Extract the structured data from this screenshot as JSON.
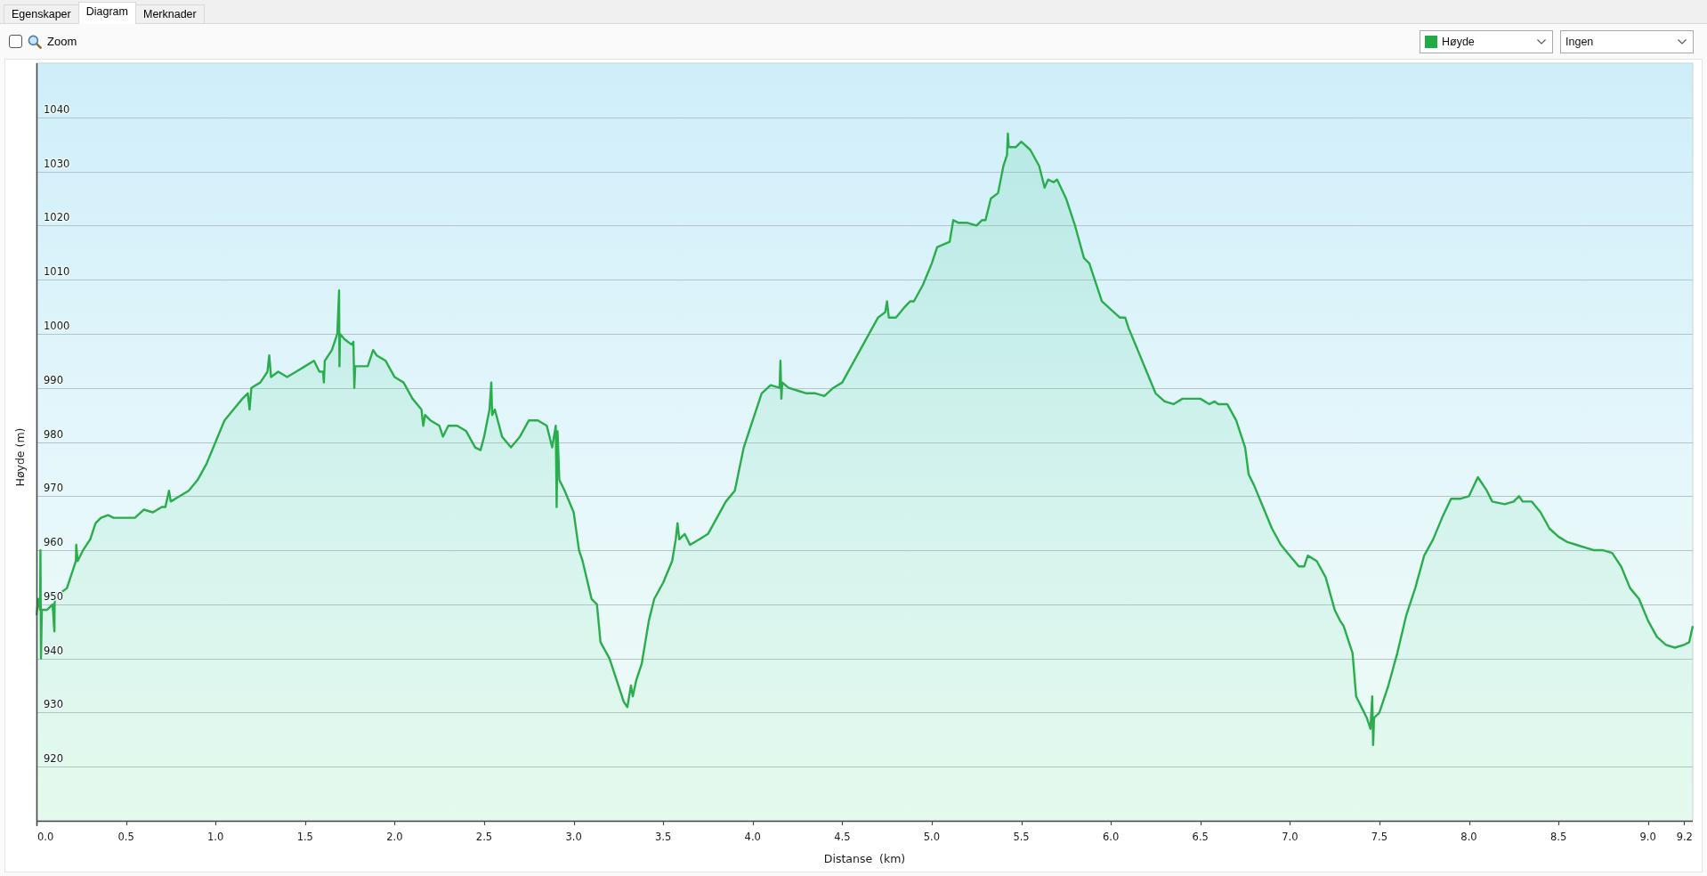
{
  "tabs": [
    {
      "label": "Egenskaper",
      "selected": false
    },
    {
      "label": "Diagram",
      "selected": true
    },
    {
      "label": "Merknader",
      "selected": false
    }
  ],
  "toolbar": {
    "zoom": {
      "label": "Zoom",
      "checked": false
    },
    "dropdowns": [
      {
        "kind": "series",
        "value": "Høyde",
        "color": "#22aa44"
      },
      {
        "kind": "plain",
        "value": "Ingen"
      }
    ]
  },
  "chart": {
    "chart_data": {
      "type": "area",
      "xlabel": "Distanse  (km)",
      "ylabel": "Høyde (m)",
      "grid": true,
      "x": [
        0,
        0.01,
        0.02,
        0.022,
        0.025,
        0.03,
        0.06,
        0.09,
        0.1,
        0.102,
        0.13,
        0.17,
        0.2,
        0.22,
        0.222,
        0.23,
        0.26,
        0.3,
        0.33,
        0.36,
        0.4,
        0.43,
        0.5,
        0.55,
        0.6,
        0.65,
        0.7,
        0.72,
        0.74,
        0.75,
        0.8,
        0.85,
        0.9,
        0.95,
        1.0,
        1.05,
        1.1,
        1.15,
        1.18,
        1.19,
        1.2,
        1.25,
        1.29,
        1.3,
        1.31,
        1.35,
        1.4,
        1.45,
        1.5,
        1.55,
        1.58,
        1.6,
        1.605,
        1.61,
        1.65,
        1.68,
        1.69,
        1.692,
        1.695,
        1.72,
        1.76,
        1.77,
        1.775,
        1.78,
        1.85,
        1.88,
        1.9,
        1.95,
        2.0,
        2.05,
        2.1,
        2.15,
        2.16,
        2.17,
        2.2,
        2.25,
        2.27,
        2.3,
        2.35,
        2.4,
        2.45,
        2.48,
        2.5,
        2.53,
        2.54,
        2.545,
        2.56,
        2.6,
        2.65,
        2.7,
        2.75,
        2.8,
        2.85,
        2.88,
        2.9,
        2.905,
        2.91,
        2.92,
        2.95,
        3.0,
        3.03,
        3.05,
        3.1,
        3.13,
        3.15,
        3.2,
        3.25,
        3.28,
        3.3,
        3.32,
        3.33,
        3.35,
        3.38,
        3.42,
        3.45,
        3.5,
        3.55,
        3.57,
        3.58,
        3.59,
        3.62,
        3.65,
        3.7,
        3.75,
        3.8,
        3.85,
        3.9,
        3.95,
        4.0,
        4.05,
        4.1,
        4.15,
        4.155,
        4.16,
        4.165,
        4.2,
        4.25,
        4.3,
        4.35,
        4.4,
        4.45,
        4.5,
        4.55,
        4.6,
        4.65,
        4.7,
        4.74,
        4.75,
        4.76,
        4.8,
        4.85,
        4.88,
        4.9,
        4.95,
        5.0,
        5.03,
        5.1,
        5.12,
        5.15,
        5.2,
        5.25,
        5.28,
        5.3,
        5.33,
        5.37,
        5.4,
        5.42,
        5.425,
        5.43,
        5.47,
        5.5,
        5.55,
        5.6,
        5.63,
        5.65,
        5.68,
        5.7,
        5.75,
        5.8,
        5.85,
        5.88,
        5.9,
        5.95,
        6.0,
        6.05,
        6.08,
        6.1,
        6.15,
        6.2,
        6.25,
        6.3,
        6.35,
        6.4,
        6.5,
        6.55,
        6.58,
        6.6,
        6.65,
        6.7,
        6.75,
        6.77,
        6.8,
        6.85,
        6.9,
        6.95,
        7.0,
        7.05,
        7.08,
        7.1,
        7.15,
        7.2,
        7.25,
        7.28,
        7.3,
        7.35,
        7.37,
        7.4,
        7.43,
        7.45,
        7.46,
        7.465,
        7.47,
        7.5,
        7.55,
        7.6,
        7.65,
        7.7,
        7.75,
        7.8,
        7.85,
        7.9,
        7.95,
        8.0,
        8.05,
        8.1,
        8.13,
        8.2,
        8.25,
        8.28,
        8.3,
        8.35,
        8.4,
        8.45,
        8.5,
        8.55,
        8.6,
        8.65,
        8.7,
        8.75,
        8.8,
        8.85,
        8.9,
        8.95,
        9.0,
        9.05,
        9.1,
        9.15,
        9.2,
        9.23,
        9.25
      ],
      "values": [
        948,
        951,
        949,
        960,
        940,
        949,
        949,
        950,
        945,
        952,
        952,
        953,
        956,
        958,
        961,
        958,
        960,
        962,
        965,
        966,
        966.5,
        966,
        966,
        966,
        967.5,
        967,
        968,
        968,
        971,
        969,
        970,
        971,
        973,
        976,
        980,
        984,
        986,
        988,
        989,
        986,
        990,
        991,
        993,
        996,
        992,
        993,
        992,
        993,
        994,
        995,
        993,
        993,
        991,
        995,
        997,
        1000,
        1008,
        994,
        1000,
        999,
        998,
        998.5,
        990,
        994,
        994,
        997,
        996,
        995,
        992,
        991,
        988,
        986,
        983,
        985,
        984,
        983,
        981,
        983,
        983,
        982,
        979,
        978.5,
        981,
        986,
        991,
        985,
        986,
        981,
        979,
        981,
        984,
        984,
        983,
        979,
        983,
        968,
        982,
        973,
        971,
        967,
        960,
        958,
        951,
        950,
        943,
        940,
        935,
        932,
        931,
        935,
        933,
        936,
        939,
        947,
        951,
        954,
        958,
        962,
        965,
        962,
        963,
        961,
        962,
        963,
        966,
        969,
        971,
        979,
        984,
        989,
        990.5,
        990,
        995,
        988,
        991,
        990,
        989.5,
        989,
        989,
        988.5,
        990,
        991,
        994,
        997,
        1000,
        1003,
        1004,
        1006,
        1003,
        1003,
        1005,
        1006,
        1006,
        1009,
        1013,
        1016,
        1017,
        1021,
        1020.5,
        1020.5,
        1020,
        1021,
        1021,
        1025,
        1026,
        1031,
        1033,
        1037,
        1034.5,
        1034.5,
        1035.5,
        1034,
        1031,
        1027,
        1028.5,
        1028,
        1028.5,
        1025,
        1020,
        1014,
        1013,
        1011,
        1006,
        1004.5,
        1003,
        1003,
        1001,
        997,
        993,
        989,
        987.5,
        987,
        988,
        988,
        987,
        987.5,
        987,
        987,
        984,
        979,
        974,
        972,
        968,
        964,
        961,
        959,
        957,
        957,
        959,
        958,
        955,
        949,
        947,
        946,
        941,
        933,
        931,
        929,
        927,
        933,
        924,
        929,
        930,
        935,
        941,
        948,
        953,
        959,
        962,
        966,
        969.5,
        969.5,
        970,
        973.5,
        971,
        969,
        968.5,
        969,
        970,
        969,
        969,
        967,
        964,
        962.5,
        961.5,
        961,
        960.5,
        960,
        960,
        959.5,
        957,
        953,
        951,
        947,
        944,
        942.5,
        942,
        942.5,
        943,
        946
      ],
      "xlim": [
        0,
        9.25
      ],
      "ylim": [
        910,
        1050
      ],
      "xticks": [
        {
          "value": 0,
          "label": "0.0"
        },
        {
          "value": 0.5,
          "label": "0.5"
        },
        {
          "value": 1,
          "label": "1.0"
        },
        {
          "value": 1.5,
          "label": "1.5"
        },
        {
          "value": 2,
          "label": "2.0"
        },
        {
          "value": 2.5,
          "label": "2.5"
        },
        {
          "value": 3,
          "label": "3.0"
        },
        {
          "value": 3.5,
          "label": "3.5"
        },
        {
          "value": 4,
          "label": "4.0"
        },
        {
          "value": 4.5,
          "label": "4.5"
        },
        {
          "value": 5,
          "label": "5.0"
        },
        {
          "value": 5.5,
          "label": "5.5"
        },
        {
          "value": 6,
          "label": "6.0"
        },
        {
          "value": 6.5,
          "label": "6.5"
        },
        {
          "value": 7,
          "label": "7.0"
        },
        {
          "value": 7.5,
          "label": "7.5"
        },
        {
          "value": 8,
          "label": "8.0"
        },
        {
          "value": 8.5,
          "label": "8.5"
        },
        {
          "value": 9,
          "label": "9.0"
        },
        {
          "value": 9.2,
          "label": "9.2"
        }
      ],
      "yticks": [
        920,
        930,
        940,
        950,
        960,
        970,
        980,
        990,
        1000,
        1010,
        1020,
        1030,
        1040
      ]
    }
  }
}
